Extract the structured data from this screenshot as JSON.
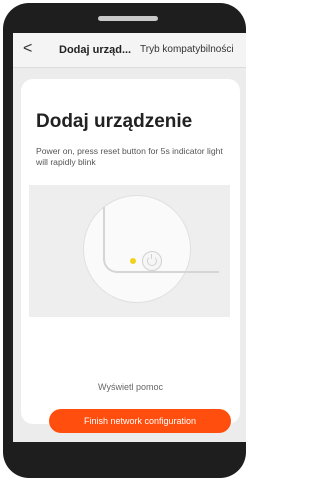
{
  "header": {
    "back_label": "<",
    "title": "Dodaj urząd...",
    "compat_link": "Tryb kompatybilności"
  },
  "main": {
    "title": "Dodaj urządzenie",
    "instructions": "Power on, press reset button for 5s indicator light will rapidly blink",
    "help_link": "Wyświetl pomoc",
    "primary_button": "Finish network configuration"
  },
  "illustration": {
    "led_color": "#f2d21c",
    "icon": "power-icon"
  },
  "colors": {
    "accent": "#ff4e0d",
    "background": "#ececec",
    "frame": "#1e1e1e"
  }
}
